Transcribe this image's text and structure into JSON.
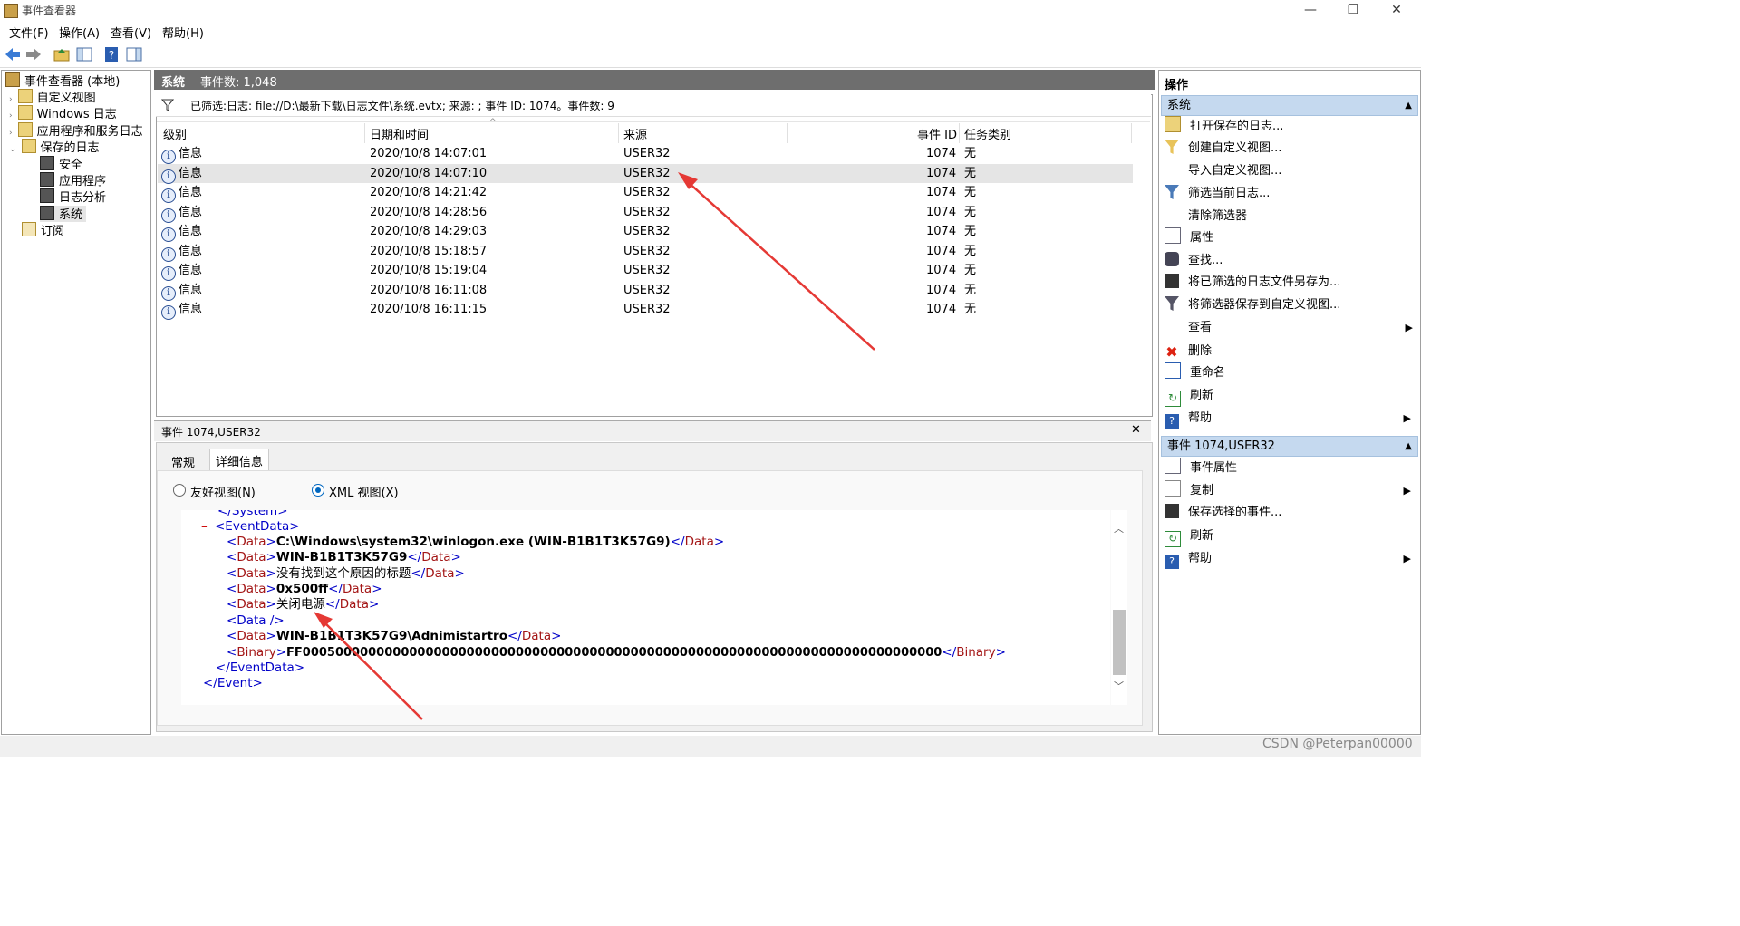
{
  "window": {
    "title": "事件查看器",
    "min": "—",
    "max": "❐",
    "close": "✕"
  },
  "menu": [
    "文件(F)",
    "操作(A)",
    "查看(V)",
    "帮助(H)"
  ],
  "tree": [
    {
      "label": "事件查看器 (本地)",
      "level": 0
    },
    {
      "label": "自定义视图",
      "level": 1
    },
    {
      "label": "Windows 日志",
      "level": 1
    },
    {
      "label": "应用程序和服务日志",
      "level": 1
    },
    {
      "label": "保存的日志",
      "level": 1
    },
    {
      "label": "安全",
      "level": 2
    },
    {
      "label": "应用程序",
      "level": 2
    },
    {
      "label": "日志分析",
      "level": 2
    },
    {
      "label": "系统",
      "level": 2
    },
    {
      "label": "订阅",
      "level": 1
    }
  ],
  "center": {
    "title": "系统",
    "count_label": "事件数: 1,048",
    "filter_text": "已筛选:日志: file://D:\\最新下载\\日志文件\\系统.evtx; 来源: ; 事件 ID: 1074。事件数: 9",
    "columns": [
      "级别",
      "日期和时间",
      "来源",
      "事件 ID",
      "任务类别"
    ],
    "rows": [
      {
        "level": "信息",
        "datetime": "2020/10/8 14:07:01",
        "source": "USER32",
        "id": "1074",
        "task": "无"
      },
      {
        "level": "信息",
        "datetime": "2020/10/8 14:07:10",
        "source": "USER32",
        "id": "1074",
        "task": "无"
      },
      {
        "level": "信息",
        "datetime": "2020/10/8 14:21:42",
        "source": "USER32",
        "id": "1074",
        "task": "无"
      },
      {
        "level": "信息",
        "datetime": "2020/10/8 14:28:56",
        "source": "USER32",
        "id": "1074",
        "task": "无"
      },
      {
        "level": "信息",
        "datetime": "2020/10/8 14:29:03",
        "source": "USER32",
        "id": "1074",
        "task": "无"
      },
      {
        "level": "信息",
        "datetime": "2020/10/8 15:18:57",
        "source": "USER32",
        "id": "1074",
        "task": "无"
      },
      {
        "level": "信息",
        "datetime": "2020/10/8 15:19:04",
        "source": "USER32",
        "id": "1074",
        "task": "无"
      },
      {
        "level": "信息",
        "datetime": "2020/10/8 16:11:08",
        "source": "USER32",
        "id": "1074",
        "task": "无"
      },
      {
        "level": "信息",
        "datetime": "2020/10/8 16:11:15",
        "source": "USER32",
        "id": "1074",
        "task": "无"
      }
    ]
  },
  "detail": {
    "title": "事件 1074,USER32",
    "close": "✕",
    "tabs": [
      "常规",
      "详细信息"
    ],
    "radio_friendly": "友好视图(N)",
    "radio_xml": "XML 视图(X)",
    "xml": {
      "system_close": "</System>",
      "eventdata_open": "<EventData>",
      "collapse": "–",
      "d1": "C:\\Windows\\system32\\winlogon.exe (WIN-B1B1T3K57G9)",
      "d2": "WIN-B1B1T3K57G9",
      "d3": "没有找到这个原因的标题",
      "d4": "0x500ff",
      "d5": "关闭电源",
      "d6": "<Data />",
      "d7": "WIN-B1B1T3K57G9\\Adnimistartro",
      "binary": "FF000500000000000000000000000000000000000000000000000000000000000000000000000000",
      "eventdata_close": "</EventData>",
      "event_close": "</Event>"
    }
  },
  "actions": {
    "title": "操作",
    "section1": "系统",
    "items1": [
      "打开保存的日志...",
      "创建自定义视图...",
      "导入自定义视图...",
      "筛选当前日志...",
      "清除筛选器",
      "属性",
      "查找...",
      "将已筛选的日志文件另存为...",
      "将筛选器保存到自定义视图...",
      "查看",
      "删除",
      "重命名",
      "刷新",
      "帮助"
    ],
    "section2": "事件 1074,USER32",
    "items2": [
      "事件属性",
      "复制",
      "保存选择的事件...",
      "刷新",
      "帮助"
    ]
  },
  "watermark": "CSDN @Peterpan00000"
}
